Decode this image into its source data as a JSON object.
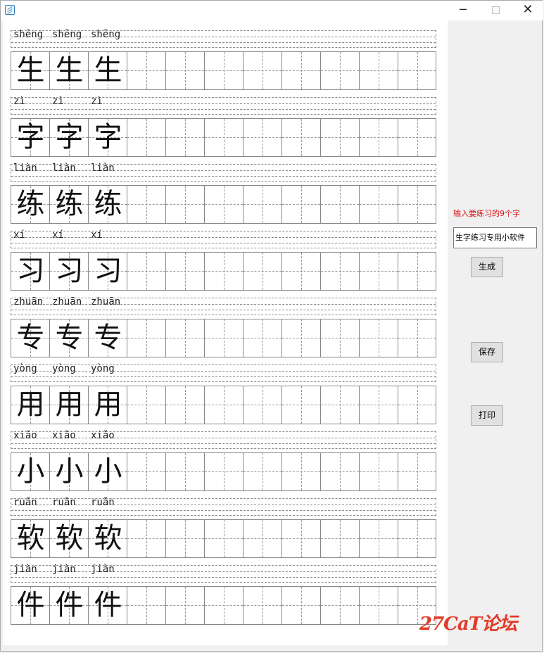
{
  "window": {
    "controls": {
      "minimize": "─",
      "close": "✕"
    }
  },
  "sheet": {
    "rows": [
      {
        "pinyin": "shēng",
        "char": "生"
      },
      {
        "pinyin": "zì",
        "char": "字"
      },
      {
        "pinyin": "liàn",
        "char": "练"
      },
      {
        "pinyin": "xí",
        "char": "习"
      },
      {
        "pinyin": "zhuān",
        "char": "专"
      },
      {
        "pinyin": "yòng",
        "char": "用"
      },
      {
        "pinyin": "xiǎo",
        "char": "小"
      },
      {
        "pinyin": "ruǎn",
        "char": "软"
      },
      {
        "pinyin": "jiàn",
        "char": "件"
      }
    ]
  },
  "panel": {
    "prompt": "输入要练习的9个字",
    "input_value": "生字练习专用小软件",
    "generate_label": "生成",
    "save_label": "保存",
    "print_label": "打印"
  },
  "watermark": "27CaT论坛",
  "colors": {
    "prompt": "#dd1111",
    "watermark": "#e23b2a"
  },
  "icons": [
    "app-icon",
    "minimize-icon",
    "maximize-icon",
    "close-icon"
  ]
}
